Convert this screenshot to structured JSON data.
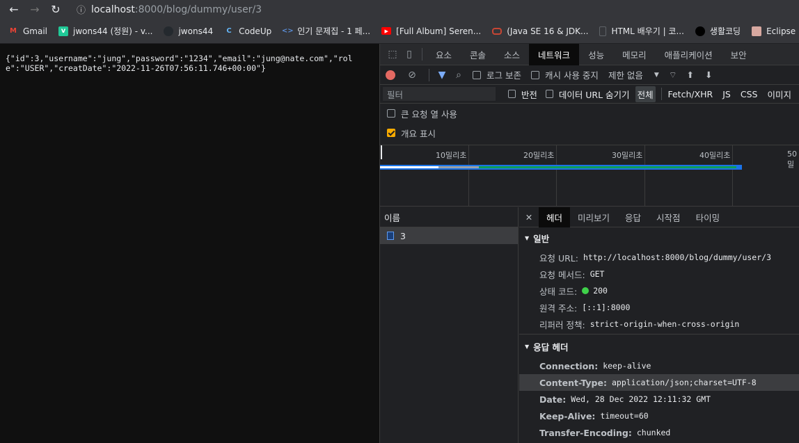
{
  "browser": {
    "url_host": "localhost",
    "url_path": ":8000/blog/dummy/user/3",
    "bookmarks": [
      {
        "label": "Gmail",
        "icon": "gmail-icon",
        "color": "#ea4335",
        "glyph": "M"
      },
      {
        "label": "jwons44 (정원) - v...",
        "icon": "velog-icon",
        "color": "#20c997",
        "glyph": "v"
      },
      {
        "label": "jwons44",
        "icon": "github-icon",
        "color": "#24292e",
        "glyph": ""
      },
      {
        "label": "CodeUp",
        "icon": "codeup-icon",
        "color": "#1565c0",
        "glyph": "C"
      },
      {
        "label": "인기 문제집 - 1 페...",
        "icon": "code-icon",
        "color": "#2b5797",
        "glyph": "<>"
      },
      {
        "label": "[Full Album] Seren...",
        "icon": "youtube-icon",
        "color": "#ff0000",
        "glyph": "▶"
      },
      {
        "label": "(Java SE 16 & JDK...",
        "icon": "oracle-icon",
        "color": "#c74634",
        "glyph": "O"
      },
      {
        "label": "HTML 배우기 | 코...",
        "icon": "document-icon",
        "color": "#5f6368",
        "glyph": ""
      },
      {
        "label": "생활코딩",
        "icon": "circle-icon",
        "color": "#000000",
        "glyph": ""
      },
      {
        "label": "Eclipse",
        "icon": "avatar-icon",
        "color": "#d7a8a0",
        "glyph": ""
      }
    ]
  },
  "page": {
    "json_text": "{\"id\":3,\"username\":\"jung\",\"password\":\"1234\",\"email\":\"jung@nate.com\",\"role\":\"USER\",\"creatDate\":\"2022-11-26T07:56:11.746+00:00\"}"
  },
  "devtools": {
    "tabs": [
      "요소",
      "콘솔",
      "소스",
      "네트워크",
      "성능",
      "메모리",
      "애플리케이션",
      "보안"
    ],
    "active_tab": "네트워크",
    "toolbar": {
      "preserve_log": "로그 보존",
      "disable_cache": "캐시 사용 중지",
      "throttle": "제한 없음"
    },
    "filter": {
      "placeholder": "필터",
      "invert": "반전",
      "hide_data_urls": "데이터 URL 숨기기",
      "types": [
        "전체",
        "Fetch/XHR",
        "JS",
        "CSS",
        "이미지"
      ]
    },
    "options": {
      "large_rows": "큰 요청 열 사용",
      "show_overview": "개요 표시"
    },
    "overview": {
      "ticks": [
        "10밀리초",
        "20밀리초",
        "30밀리초",
        "40밀리초",
        "50밀"
      ]
    },
    "names": {
      "header": "이름",
      "items": [
        "3"
      ]
    },
    "detail": {
      "tabs": [
        "헤더",
        "미리보기",
        "응답",
        "시작점",
        "타이밍"
      ],
      "general_title": "일반",
      "general": [
        {
          "k": "요청 URL:",
          "v": "http://localhost:8000/blog/dummy/user/3"
        },
        {
          "k": "요청 메서드:",
          "v": "GET"
        },
        {
          "k": "상태 코드:",
          "v": "200"
        },
        {
          "k": "원격 주소:",
          "v": "[::1]:8000"
        },
        {
          "k": "리퍼러 정책:",
          "v": "strict-origin-when-cross-origin"
        }
      ],
      "response_title": "응답 헤더",
      "response": [
        {
          "k": "Connection:",
          "v": "keep-alive"
        },
        {
          "k": "Content-Type:",
          "v": "application/json;charset=UTF-8"
        },
        {
          "k": "Date:",
          "v": "Wed, 28 Dec 2022 12:11:32 GMT"
        },
        {
          "k": "Keep-Alive:",
          "v": "timeout=60"
        },
        {
          "k": "Transfer-Encoding:",
          "v": "chunked"
        }
      ]
    }
  }
}
